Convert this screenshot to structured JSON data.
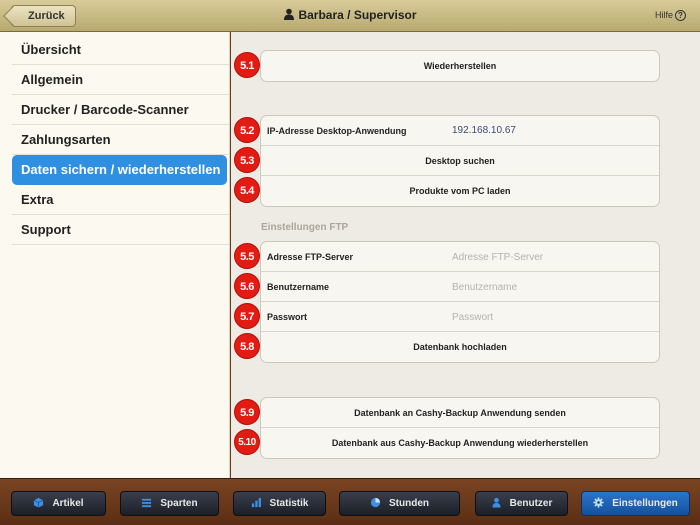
{
  "header": {
    "back_label": "Zurück",
    "user_title": "Barbara / Supervisor",
    "help_label": "Hilfe"
  },
  "sidebar": {
    "items": [
      {
        "label": "Übersicht"
      },
      {
        "label": "Allgemein"
      },
      {
        "label": "Drucker / Barcode-Scanner"
      },
      {
        "label": "Zahlungsarten"
      },
      {
        "label": "Daten sichern / wiederherstellen",
        "active": true
      },
      {
        "label": "Extra"
      },
      {
        "label": "Support"
      }
    ]
  },
  "main": {
    "restore_button": "Wiederherstellen",
    "ip_label": "IP-Adresse Desktop-Anwendung",
    "ip_value": "192.168.10.67",
    "search_desktop": "Desktop suchen",
    "load_products": "Produkte vom PC laden",
    "ftp_section": "Einstellungen FTP",
    "ftp_server_label": "Adresse FTP-Server",
    "ftp_server_placeholder": "Adresse FTP-Server",
    "username_label": "Benutzername",
    "username_placeholder": "Benutzername",
    "password_label": "Passwort",
    "password_placeholder": "Passwort",
    "upload_db": "Datenbank hochladen",
    "send_backup": "Datenbank an Cashy-Backup Anwendung senden",
    "restore_backup": "Datenbank aus Cashy-Backup Anwendung wiederherstellen"
  },
  "badges": [
    "5.1",
    "5.2",
    "5.3",
    "5.4",
    "5.5",
    "5.6",
    "5.7",
    "5.8",
    "5.9",
    "5.10"
  ],
  "bottom_tabs": [
    {
      "label": "Artikel",
      "icon": "box-icon"
    },
    {
      "label": "Sparten",
      "icon": "list-icon"
    },
    {
      "label": "Statistik",
      "icon": "bar-chart-icon"
    },
    {
      "label": "Stunden",
      "icon": "pie-clock-icon"
    },
    {
      "label": "Benutzer",
      "icon": "user-icon"
    },
    {
      "label": "Einstellungen",
      "icon": "gear-icon",
      "active": true
    }
  ],
  "colors": {
    "accent": "#2f8fe0",
    "badge": "#e31b13",
    "header": "#c9bc85",
    "bottom_bar": "#6b3a1c"
  }
}
